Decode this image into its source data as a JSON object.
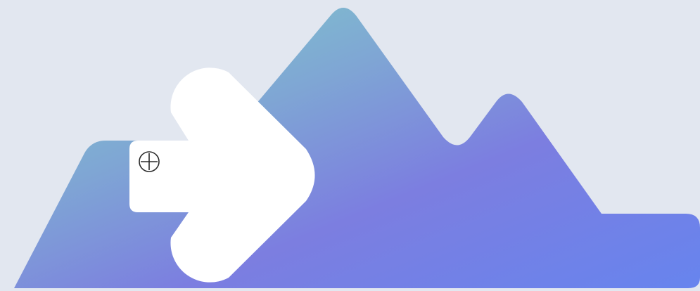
{
  "background_color": "#e2e7f0",
  "mountains": {
    "gradient_colors": [
      "#80d2c8",
      "#7fa6d4",
      "#7c7ee0",
      "#6784ee"
    ],
    "icon": "mountains-icon"
  },
  "arrow": {
    "color": "#ffffff",
    "icon": "arrow-right-icon"
  },
  "add_marker": {
    "icon": "circle-plus-icon",
    "stroke_color": "#2a2a2a"
  }
}
